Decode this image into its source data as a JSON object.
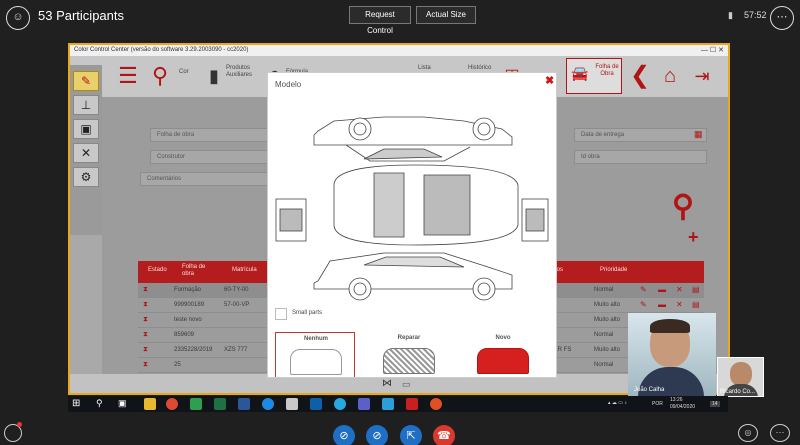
{
  "meeting": {
    "participants_label": "53 Participants",
    "request_control_label": "Request Control",
    "actual_size_label": "Actual Size",
    "clock": "57:52"
  },
  "app": {
    "window_title": "Color Control Center (versão do software 3.29.2003090 - cc2020)",
    "window_controls": "— ☐ ✕",
    "toolbar": {
      "cor_label": "Cor",
      "produtos_label": "Produtos Auxiliares",
      "formula_label": "Fórmula",
      "lista_label": "Lista",
      "historico_label": "Histórico",
      "folha_label": "Folha de Obra"
    },
    "form": {
      "folha_placeholder": "Folha de obra",
      "construtor_placeholder": "Construtor",
      "comentarios_placeholder": "Comentários",
      "data_entrega_placeholder": "Data de entrega",
      "id_obra_placeholder": "Id obra"
    },
    "grid": {
      "headers": [
        "Estado",
        "Folha de obra",
        "Matrícula",
        "ários",
        "Prioridade"
      ],
      "rows": [
        {
          "folha": "Formação",
          "matricula": "60-TY-00",
          "extra": "",
          "prioridade": "Normal"
        },
        {
          "folha": "999900189",
          "matricula": "57-00-VP",
          "extra": "",
          "prioridade": "Muito alto"
        },
        {
          "folha": "teste novo",
          "matricula": "",
          "extra": "",
          "prioridade": "Muito alto"
        },
        {
          "folha": "859609",
          "matricula": "",
          "extra": "",
          "prioridade": "Normal"
        },
        {
          "folha": "2335228/2019",
          "matricula": "XZS 777",
          "extra": "TER FS",
          "prioridade": "Muito alto"
        },
        {
          "folha": "25",
          "matricula": "",
          "extra": "",
          "prioridade": "Normal"
        }
      ]
    }
  },
  "modal": {
    "title": "Modelo",
    "close_glyph": "✖",
    "small_parts_label": "Small parts",
    "options": [
      {
        "label": "Nenhum"
      },
      {
        "label": "Reparar"
      },
      {
        "label": "Novo"
      }
    ]
  },
  "video": {
    "participant1": "João Calha",
    "participant2": "Ricardo Co..."
  },
  "taskbar": {
    "language": "POR",
    "time": "13:26",
    "date": "09/04/2020",
    "notifications": "14"
  },
  "colors": {
    "brand_red": "#b01515",
    "frame_orange": "#e8a818",
    "hangup_red": "#d93a2f",
    "call_blue": "#1f6fc5"
  }
}
